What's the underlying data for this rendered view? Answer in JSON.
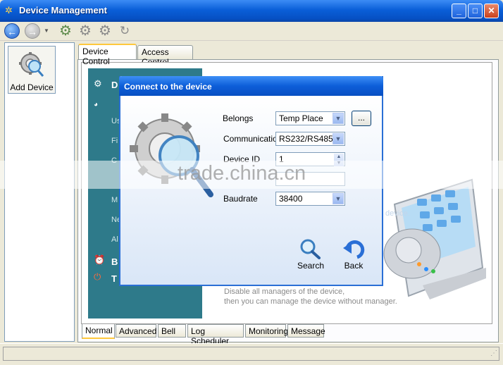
{
  "window": {
    "title": "Device Management"
  },
  "sidebar": {
    "add_device_label": "Add Device"
  },
  "main_tabs": [
    {
      "label": "Device Control"
    },
    {
      "label": "Access Control"
    }
  ],
  "panel": {
    "menu_letters": [
      "D",
      "Us",
      "Fi",
      "C",
      "M",
      "Ne",
      "Al",
      "B",
      "T"
    ],
    "hint_line1": "Disable all managers of the device,",
    "hint_line2": "then you can manage the device without manager.",
    "device_hint": "device."
  },
  "bottom_tabs": [
    {
      "label": "Normal"
    },
    {
      "label": "Advanced"
    },
    {
      "label": "Bell"
    },
    {
      "label": "Log Scheduler"
    },
    {
      "label": "Monitoring"
    },
    {
      "label": "Message"
    }
  ],
  "dialog": {
    "title": "Connect to the device",
    "belongs_label": "Belongs",
    "belongs_value": "Temp Place",
    "browse_label": "...",
    "communication_label": "Communication",
    "communication_value": "RS232/RS485",
    "device_id_label": "Device ID",
    "device_id_value": "1",
    "baudrate_label": "Baudrate",
    "baudrate_value": "38400",
    "search_label": "Search",
    "back_label": "Back"
  },
  "watermark": "trade.china.cn",
  "colors": {
    "titlebar": "#0a5fd8",
    "teal_panel": "#2e7a8a",
    "tab_highlight": "#ffc83c"
  }
}
